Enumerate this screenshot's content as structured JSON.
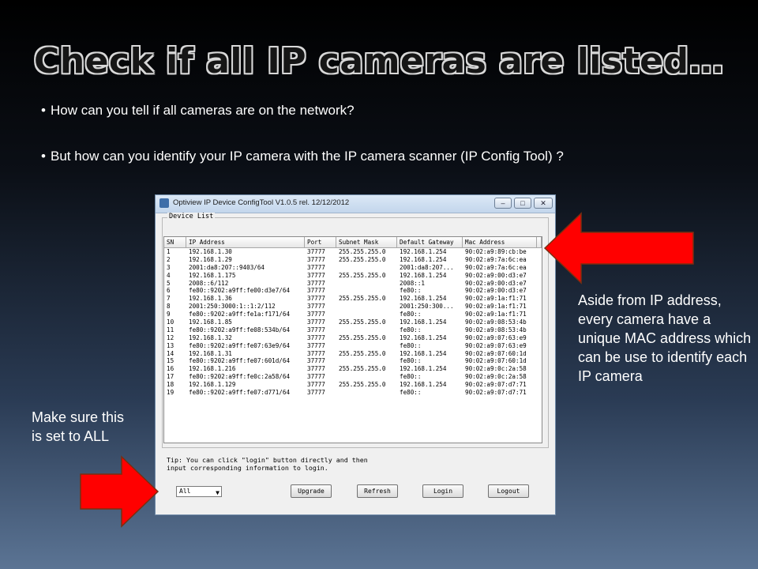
{
  "slide": {
    "title": "Check if all IP cameras are listed…",
    "bullets": [
      "How can you tell if all cameras are on the network?",
      "But how can you identify your IP camera with the IP camera scanner (IP Config Tool) ?"
    ],
    "note_right": "Aside from IP address, every camera have a unique MAC address which can be use to identify each IP camera",
    "note_left": "Make sure this is set to ALL",
    "arrow_color": "#ff0000"
  },
  "window": {
    "title": "Optiview IP Device ConfigTool V1.0.5 rel. 12/12/2012",
    "group_label": "Device List",
    "columns": [
      "SN",
      "IP Address",
      "Port",
      "Subnet Mask",
      "Default Gateway",
      "Mac Address"
    ],
    "rows": [
      [
        "1",
        "192.168.1.30",
        "37777",
        "255.255.255.0",
        "192.168.1.254",
        "90:02:a9:89:cb:be"
      ],
      [
        "2",
        "192.168.1.29",
        "37777",
        "255.255.255.0",
        "192.168.1.254",
        "90:02:a9:7a:6c:ea"
      ],
      [
        "3",
        "2001:da8:207::9403/64",
        "37777",
        "",
        "2001:da8:207...",
        "90:02:a9:7a:6c:ea"
      ],
      [
        "4",
        "192.168.1.175",
        "37777",
        "255.255.255.0",
        "192.168.1.254",
        "90:02:a9:00:d3:e7"
      ],
      [
        "5",
        "2008::6/112",
        "37777",
        "",
        "2008::1",
        "90:02:a9:00:d3:e7"
      ],
      [
        "6",
        "fe80::9202:a9ff:fe00:d3e7/64",
        "37777",
        "",
        "fe80::",
        "90:02:a9:00:d3:e7"
      ],
      [
        "7",
        "192.168.1.36",
        "37777",
        "255.255.255.0",
        "192.168.1.254",
        "90:02:a9:1a:f1:71"
      ],
      [
        "8",
        "2001:250:3000:1::1:2/112",
        "37777",
        "",
        "2001:250:300...",
        "90:02:a9:1a:f1:71"
      ],
      [
        "9",
        "fe80::9202:a9ff:fe1a:f171/64",
        "37777",
        "",
        "fe80::",
        "90:02:a9:1a:f1:71"
      ],
      [
        "10",
        "192.168.1.85",
        "37777",
        "255.255.255.0",
        "192.168.1.254",
        "90:02:a9:08:53:4b"
      ],
      [
        "11",
        "fe80::9202:a9ff:fe08:534b/64",
        "37777",
        "",
        "fe80::",
        "90:02:a9:08:53:4b"
      ],
      [
        "12",
        "192.168.1.32",
        "37777",
        "255.255.255.0",
        "192.168.1.254",
        "90:02:a9:07:63:e9"
      ],
      [
        "13",
        "fe80::9202:a9ff:fe07:63e9/64",
        "37777",
        "",
        "fe80::",
        "90:02:a9:07:63:e9"
      ],
      [
        "14",
        "192.168.1.31",
        "37777",
        "255.255.255.0",
        "192.168.1.254",
        "90:02:a9:07:60:1d"
      ],
      [
        "15",
        "fe80::9202:a9ff:fe07:601d/64",
        "37777",
        "",
        "fe80::",
        "90:02:a9:07:60:1d"
      ],
      [
        "16",
        "192.168.1.216",
        "37777",
        "255.255.255.0",
        "192.168.1.254",
        "90:02:a9:0c:2a:58"
      ],
      [
        "17",
        "fe80::9202:a9ff:fe0c:2a58/64",
        "37777",
        "",
        "fe80::",
        "90:02:a9:0c:2a:58"
      ],
      [
        "18",
        "192.168.1.129",
        "37777",
        "255.255.255.0",
        "192.168.1.254",
        "90:02:a9:07:d7:71"
      ],
      [
        "19",
        "fe80::9202:a9ff:fe07:d771/64",
        "37777",
        "",
        "fe80::",
        "90:02:a9:07:d7:71"
      ]
    ],
    "tip": "Tip: You can click \"login\" button directly and then input corresponding information to login.",
    "filter_value": "All",
    "buttons": {
      "upgrade": "Upgrade",
      "refresh": "Refresh",
      "login": "Login",
      "logout": "Logout"
    }
  }
}
